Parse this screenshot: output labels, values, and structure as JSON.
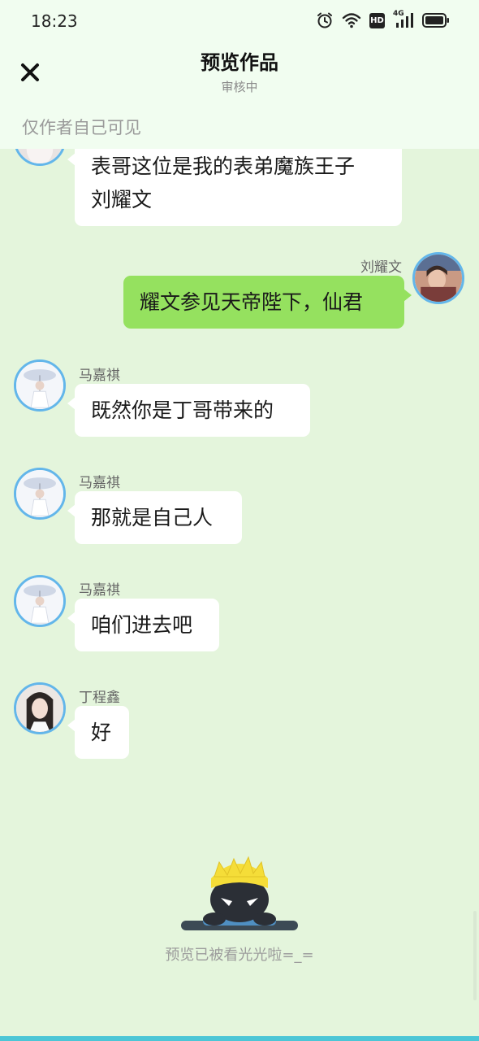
{
  "status_bar": {
    "time": "18:23",
    "network": "4G",
    "hd_label": "HD"
  },
  "header": {
    "title": "预览作品",
    "subtitle": "审核中",
    "visibility_note": "仅作者自己可见"
  },
  "messages": [
    {
      "side": "left",
      "sender": "",
      "text_lines": [
        "表哥这位是我的表弟魔族王子",
        "刘耀文"
      ]
    },
    {
      "side": "right",
      "sender": "刘耀文",
      "text": "耀文参见天帝陛下，仙君"
    },
    {
      "side": "left",
      "sender": "马嘉祺",
      "text": "既然你是丁哥带来的"
    },
    {
      "side": "left",
      "sender": "马嘉祺",
      "text": "那就是自己人"
    },
    {
      "side": "left",
      "sender": "马嘉祺",
      "text": "咱们进去吧"
    },
    {
      "side": "left",
      "sender": "丁程鑫",
      "text": "好"
    }
  ],
  "footer": {
    "end_text": "预览已被看光光啦=_="
  },
  "colors": {
    "background": "#e4f5dc",
    "header_bg": "#f1fdf0",
    "bubble_left": "#ffffff",
    "bubble_right": "#95e15f",
    "avatar_ring": "#63b6ea",
    "bottom_bar": "#4cc6d6"
  },
  "icons": [
    "alarm-icon",
    "wifi-icon",
    "hd-icon",
    "signal-icon",
    "battery-icon",
    "close-icon"
  ]
}
